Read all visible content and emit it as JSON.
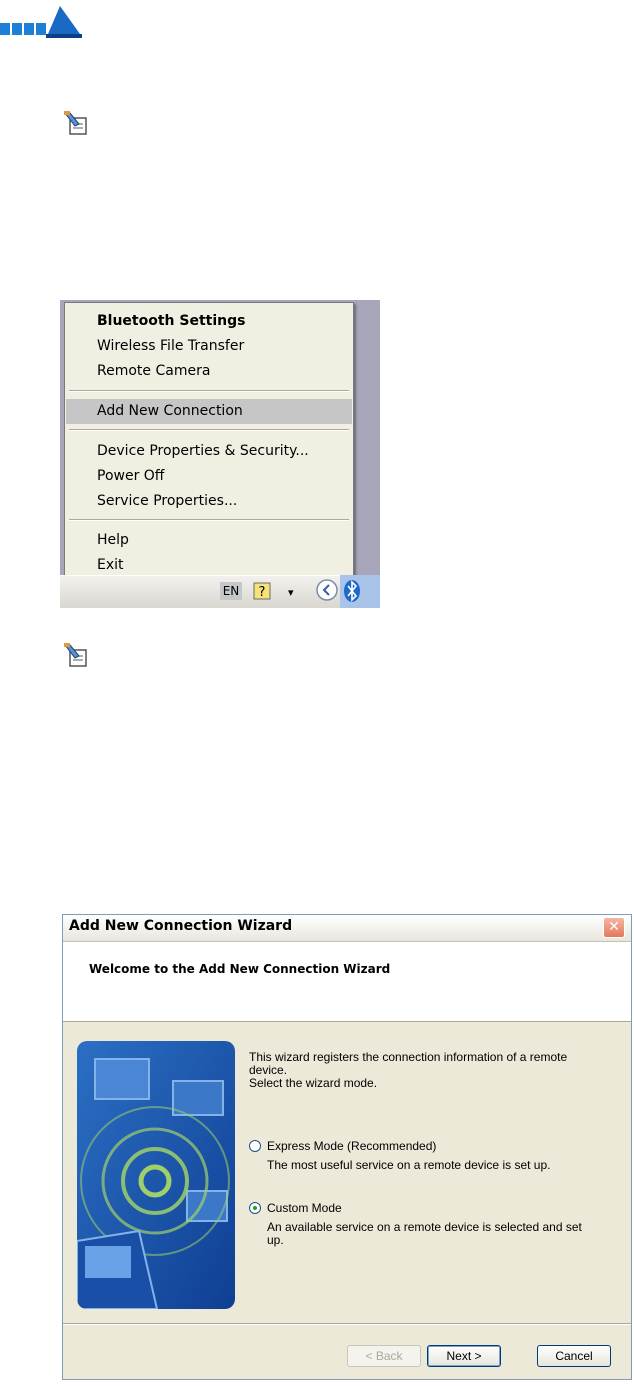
{
  "nav": {
    "icon": "next-page-arrow-icon"
  },
  "notes": [
    {
      "icon": "memo-pencil-icon"
    },
    {
      "icon": "memo-pencil-icon"
    }
  ],
  "context_menu": {
    "sections": [
      [
        {
          "label": "Bluetooth Settings",
          "bold": true
        },
        {
          "label": "Wireless File Transfer"
        },
        {
          "label": "Remote Camera"
        }
      ],
      [
        {
          "label": "Add New Connection",
          "highlighted": true
        }
      ],
      [
        {
          "label": "Device Properties & Security..."
        },
        {
          "label": "Power Off"
        },
        {
          "label": "Service Properties..."
        }
      ],
      [
        {
          "label": "Help"
        },
        {
          "label": "Exit"
        }
      ]
    ],
    "taskbar": {
      "language": "EN",
      "icons": [
        "help-icon",
        "show-hidden-icons-chevron",
        "bluetooth-icon"
      ]
    }
  },
  "wizard": {
    "title": "Add New Connection Wizard",
    "header": "Welcome to the Add New Connection Wizard",
    "intro_line1": "This wizard registers the connection information of a remote",
    "intro_line2": "device.",
    "intro_line3": "Select the wizard mode.",
    "options": [
      {
        "label": "Express Mode (Recommended)",
        "desc_line1": "The most useful service on a remote device is set up.",
        "desc_line2": "",
        "selected": false
      },
      {
        "label": "Custom Mode",
        "desc_line1": "An available service on a remote device is selected and set",
        "desc_line2": "up.",
        "selected": true
      }
    ],
    "buttons": {
      "back": "< Back",
      "next": "Next >",
      "cancel": "Cancel"
    },
    "colors": {
      "accent": "#0a246a",
      "panel": "#ece9d8",
      "art_blue": "#1f5db3"
    }
  }
}
